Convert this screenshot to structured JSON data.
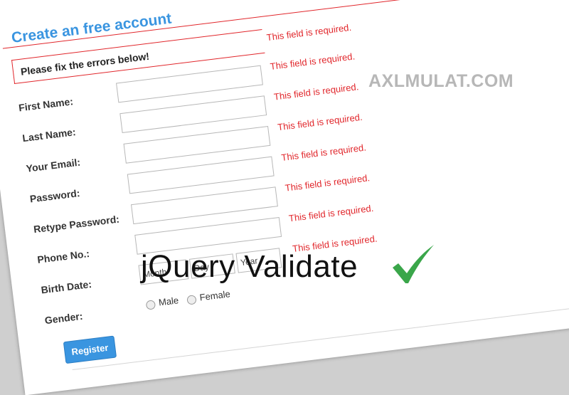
{
  "form": {
    "title": "Create an free account",
    "error_summary": "Please fix the errors below!",
    "error_message": "This field is required.",
    "fields": [
      {
        "label": "First Name:"
      },
      {
        "label": "Last Name:"
      },
      {
        "label": "Your Email:"
      },
      {
        "label": "Password:"
      },
      {
        "label": "Retype Password:"
      },
      {
        "label": "Phone No.:"
      }
    ],
    "birth_date": {
      "label": "Birth Date:",
      "month": "Month",
      "day": "Day",
      "year": "Year"
    },
    "gender": {
      "label": "Gender:",
      "options": [
        "Male",
        "Female"
      ]
    },
    "register_label": "Register"
  },
  "watermark": "AXLMULAT.COM",
  "headline": "jQuery Validate",
  "colors": {
    "accent": "#3a95e0",
    "error": "#e1262b",
    "check": "#3aa64a"
  }
}
